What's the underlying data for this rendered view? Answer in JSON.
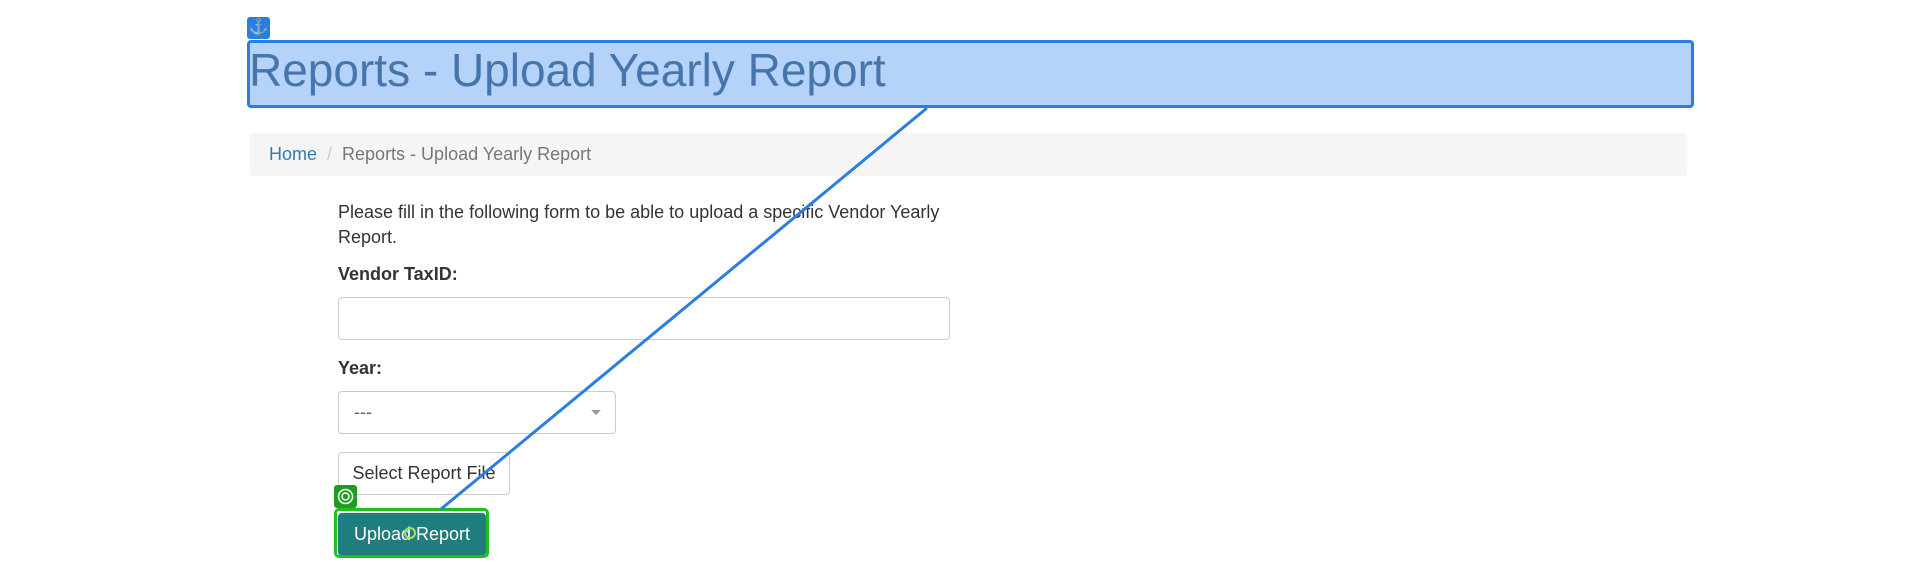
{
  "header": {
    "title": "Reports - Upload Yearly Report"
  },
  "breadcrumb": {
    "home": "Home",
    "separator": "/",
    "current": "Reports - Upload Yearly Report"
  },
  "form": {
    "intro": "Please fill in the following form to be able to upload a specific Vendor Yearly Report.",
    "vendor_taxid_label": "Vendor TaxID:",
    "vendor_taxid_value": "",
    "year_label": "Year:",
    "year_selected": "---",
    "select_file_label": "Select Report File",
    "upload_label": "Upload Report"
  },
  "icons": {
    "anchor": "anchor-icon",
    "target": "target-icon",
    "caret": "chevron-down-icon"
  },
  "colors": {
    "title": "#2a4d6e",
    "link": "#337ab7",
    "primary_button": "#1f7d7d",
    "overlay_blue": "#2a7de1",
    "overlay_green": "#1fbf1f"
  }
}
